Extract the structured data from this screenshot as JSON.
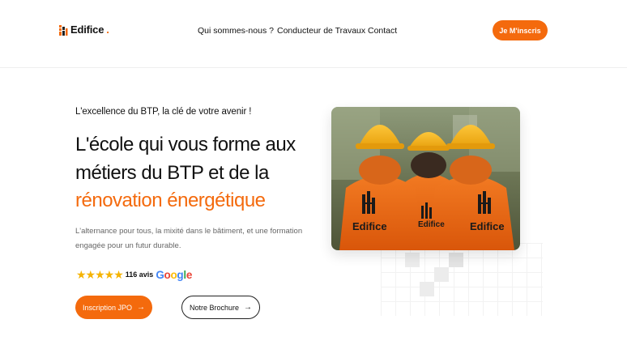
{
  "header": {
    "logo_text": "Edifice",
    "logo_dot": ".",
    "nav": [
      "Qui sommes-nous ?",
      "Conducteur de Travaux",
      "Contact"
    ],
    "cta": "Je M'inscris"
  },
  "hero": {
    "eyebrow": "L'excellence du BTP, la clé de votre avenir !",
    "title_line1": "L'école qui vous forme aux",
    "title_line2": "métiers du BTP et de la",
    "title_highlight": "rénovation énergétique",
    "subtitle_line1": "L'alternance pour tous, la mixité dans le bâtiment, et une formation",
    "subtitle_line2": "engagée pour un futur durable.",
    "rating": {
      "stars": "★★★★★",
      "star_count": 5,
      "reviews": "116 avis",
      "platform": "Google"
    },
    "primary_button": "Inscription JPO",
    "secondary_button": "Notre Brochure",
    "photo_jacket_text": "Edifice"
  },
  "colors": {
    "accent": "#f46a0d",
    "text": "#111111",
    "muted": "#666666",
    "star": "#f5b301",
    "helmet": "#f6b21a"
  },
  "icons": [
    "logo-building-icon",
    "arrow-right-icon",
    "google-logo"
  ]
}
